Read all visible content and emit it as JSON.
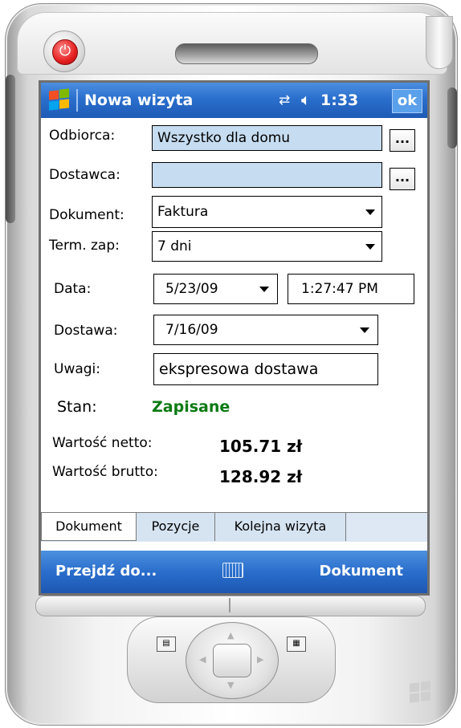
{
  "window": {
    "title": "Nowa wizyta",
    "clock": "1:33",
    "ok_label": "ok",
    "icons": [
      "windows-start-icon",
      "connectivity-icon",
      "volume-icon"
    ]
  },
  "form": {
    "odbiorca": {
      "label": "Odbiorca:",
      "value": "Wszystko dla domu",
      "button": "..."
    },
    "dostawca": {
      "label": "Dostawca:",
      "value": "",
      "button": "..."
    },
    "dokument": {
      "label": "Dokument:",
      "value": "Faktura"
    },
    "term_zap": {
      "label": "Term. zap:",
      "value": "7 dni"
    },
    "data": {
      "label": "Data:",
      "date": "5/23/09",
      "time": "1:27:47 PM"
    },
    "dostawa": {
      "label": "Dostawa:",
      "value": "7/16/09"
    },
    "uwagi": {
      "label": "Uwagi:",
      "value": "ekspresowa dostawa"
    },
    "stan": {
      "label": "Stan:",
      "value": "Zapisane"
    },
    "wartosc_netto": {
      "label": "Wartość netto:",
      "value": "105.71 zł"
    },
    "wartosc_brutto": {
      "label": "Wartość brutto:",
      "value": "128.92 zł"
    }
  },
  "tabs": [
    {
      "label": "Dokument",
      "active": true
    },
    {
      "label": "Pozycje",
      "active": false
    },
    {
      "label": "Kolejna wizyta",
      "active": false
    }
  ],
  "softkeys": {
    "left": "Przejdź do...",
    "right": "Dokument",
    "center_icon": "keyboard-icon"
  },
  "colors": {
    "titlebar": "#2a6fcd",
    "field_blue": "#c6dcf0",
    "status_green": "#0a7a12",
    "power_red": "#e51f1f"
  }
}
